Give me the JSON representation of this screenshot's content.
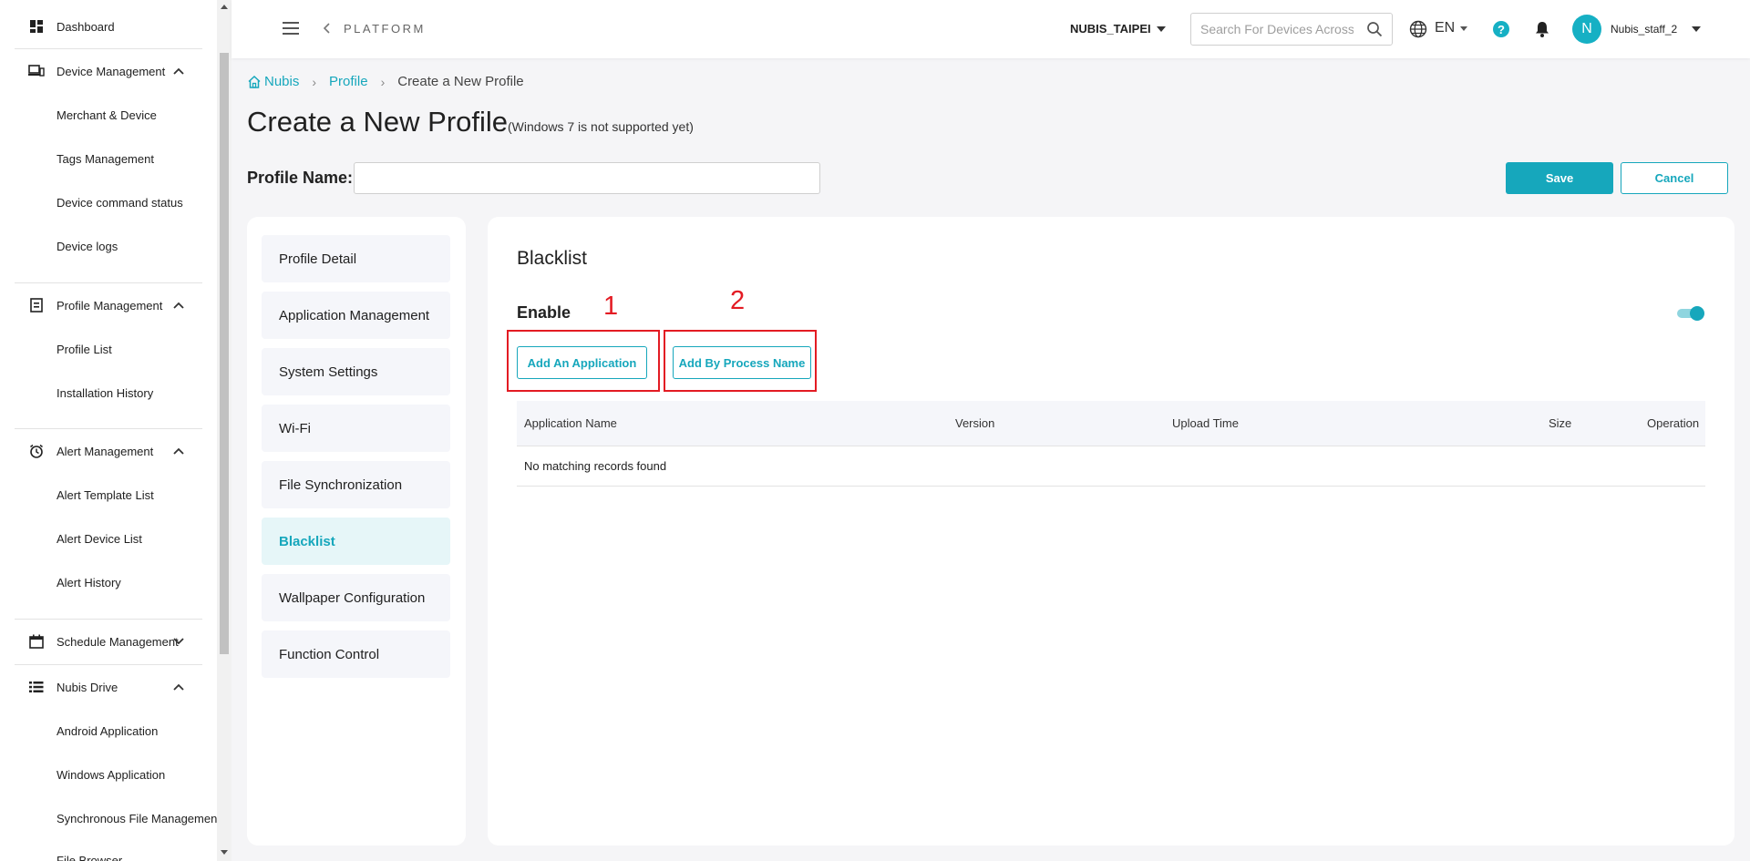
{
  "sidebar": {
    "items": [
      {
        "label": "Dashboard",
        "icon": "dashboard-icon"
      },
      {
        "label": "Device Management",
        "icon": "devices-icon",
        "expanded": true,
        "children": [
          "Merchant & Device",
          "Tags Management",
          "Device command status",
          "Device logs"
        ]
      },
      {
        "label": "Profile Management",
        "icon": "profile-icon",
        "expanded": true,
        "children": [
          "Profile List",
          "Installation History"
        ]
      },
      {
        "label": "Alert Management",
        "icon": "alarm-icon",
        "expanded": true,
        "children": [
          "Alert Template List",
          "Alert Device List",
          "Alert History"
        ]
      },
      {
        "label": "Schedule Management",
        "icon": "calendar-icon",
        "expanded": false,
        "children": []
      },
      {
        "label": "Nubis Drive",
        "icon": "list-icon",
        "expanded": true,
        "children": [
          "Android Application",
          "Windows Application",
          "Synchronous File Management",
          "File Browser"
        ]
      }
    ]
  },
  "header": {
    "platform": "PLATFORM",
    "org": "NUBIS_TAIPEI",
    "search_placeholder": "Search For Devices Across",
    "language": "EN",
    "help": "?",
    "avatar_initial": "N",
    "username": "Nubis_staff_2"
  },
  "breadcrumb": {
    "home": "Nubis",
    "profile": "Profile",
    "current": "Create a New Profile"
  },
  "page": {
    "title": "Create a New Profile",
    "note": "(Windows 7 is not supported yet)",
    "profile_name_label": "Profile Name:",
    "profile_name_value": "",
    "save_label": "Save",
    "cancel_label": "Cancel"
  },
  "profile_nav": {
    "items": [
      "Profile Detail",
      "Application Management",
      "System Settings",
      "Wi-Fi",
      "File Synchronization",
      "Blacklist",
      "Wallpaper Configuration",
      "Function Control"
    ],
    "active": "Blacklist"
  },
  "blacklist": {
    "title": "Blacklist",
    "enable_label": "Enable",
    "enabled": true,
    "add_app_label": "Add An Application",
    "add_process_label": "Add By Process Name",
    "annotations": [
      "1",
      "2"
    ],
    "table": {
      "columns": [
        "Application Name",
        "Version",
        "Upload Time",
        "Size",
        "Operation"
      ],
      "empty_message": "No matching records found"
    }
  },
  "colors": {
    "accent": "#16a7bc",
    "annotation": "#e31b23"
  }
}
